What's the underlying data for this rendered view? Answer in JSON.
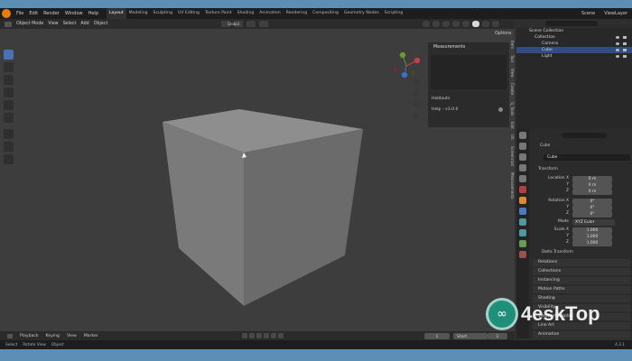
{
  "topbar": {
    "menu": [
      "File",
      "Edit",
      "Render",
      "Window",
      "Help"
    ],
    "workspaces": [
      "Layout",
      "Modeling",
      "Sculpting",
      "UV Editing",
      "Texture Paint",
      "Shading",
      "Animation",
      "Rendering",
      "Compositing",
      "Geometry Nodes",
      "Scripting"
    ],
    "scene": "Scene",
    "view_layer": "ViewLayer"
  },
  "viewport": {
    "mode": "Object Mode",
    "menu": [
      "View",
      "Select",
      "Add",
      "Object"
    ],
    "transform_orientation": "Global",
    "options_label": "Options"
  },
  "npanel": {
    "measurements": "Measurements",
    "holdouts": "Holdouts",
    "help": "Help - v3.0.0"
  },
  "ntabs": [
    "Item",
    "Tool",
    "View",
    "Create",
    "Q_Tools",
    "Edit",
    "Uti",
    "Screencast",
    "Measurements"
  ],
  "timeline": {
    "menu": [
      "Playback",
      "Keying",
      "View",
      "Marker"
    ],
    "current_frame": "1",
    "start_label": "Start",
    "start": "1"
  },
  "status": {
    "select": "Select",
    "rotate": "Rotate View",
    "object": "Object",
    "version": "4.3.1"
  },
  "outliner": {
    "root": "Scene Collection",
    "collection": "Collection",
    "camera": "Camera",
    "cube": "Cube",
    "light": "Light"
  },
  "properties": {
    "object_name": "Cube",
    "object_field": "Cube",
    "transform": "Transform",
    "location_label": "Location X",
    "rotation_label": "Rotation X",
    "mode_label": "Mode",
    "mode_value": "XYZ Euler",
    "scale_label": "Scale X",
    "y_label": "Y",
    "z_label": "Z",
    "loc": [
      "0 m",
      "0 m",
      "0 m"
    ],
    "rot": [
      "0°",
      "0°",
      "0°"
    ],
    "scale": [
      "1.000",
      "1.000",
      "1.000"
    ],
    "delta": "Delta Transform",
    "sections": [
      "Relations",
      "Collections",
      "Instancing",
      "Motion Paths",
      "Shading",
      "Visibility",
      "Viewport Display",
      "Line Art",
      "Animation"
    ]
  },
  "watermark": {
    "brand": "4eskTop"
  },
  "colors": {
    "accent": "#4772b3",
    "selected_row": "#334d80",
    "desktop_bg": "#5b8fb5"
  }
}
